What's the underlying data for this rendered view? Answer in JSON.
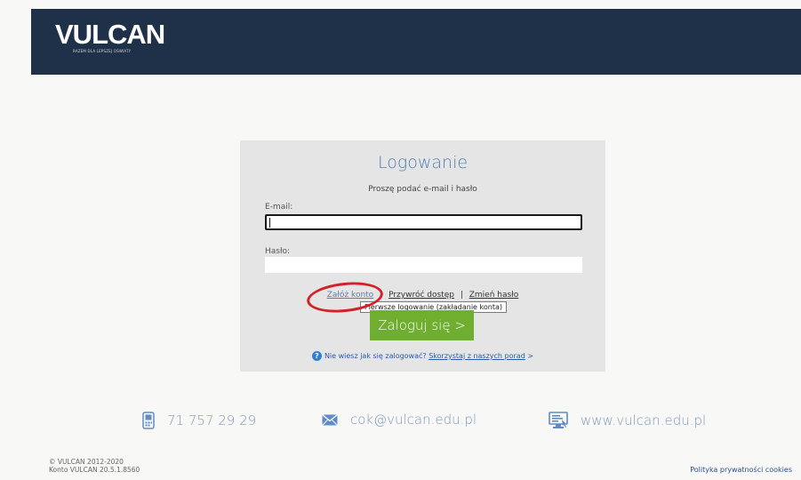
{
  "header": {
    "logo_text": "VULCAN",
    "logo_tagline": "RAZEM DLA LEPSZEJ OŚWIATY"
  },
  "login": {
    "title": "Logowanie",
    "subtitle": "Proszę podać e-mail i hasło",
    "email_label": "E-mail:",
    "email_value": "",
    "password_label": "Hasło:",
    "password_value": "",
    "link_register": "Załóż konto",
    "link_restore": "Przywróć dostęp",
    "link_separator": "|",
    "link_change": "Zmień hasło",
    "tooltip": "Pierwsze logowanie (zakładanie konta)",
    "button": "Zaloguj się >",
    "help_icon": "?",
    "help_text": "Nie wiesz jak się zalogować?",
    "help_link": "Skorzystaj z naszych porad",
    "help_arrow": ">"
  },
  "contact": {
    "phone": "71 757 29 29",
    "email": "cok@vulcan.edu.pl",
    "website": "www.vulcan.edu.pl"
  },
  "footer": {
    "copyright": "© VULCAN 2012-2020",
    "version": "Konto VULCAN 20.5.1.8560",
    "cookies": "Polityka prywatności cookies"
  },
  "colors": {
    "header_bg": "#1f3149",
    "button_green": "#6fae2f",
    "annotation_red": "#d3212a",
    "title_blue": "#4f7fb3"
  }
}
